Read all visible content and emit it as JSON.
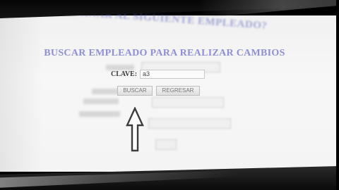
{
  "ghost": {
    "title": "DESEA ELIMINAR AL SIGUIENTE EMPLEADO?"
  },
  "page": {
    "heading": "BUSCAR EMPLEADO PARA REALIZAR CAMBIOS"
  },
  "form": {
    "clave_label": "CLAVE:",
    "clave_value": "a3"
  },
  "buttons": {
    "buscar": "BUSCAR",
    "regresar": "REGRESAR"
  },
  "colors": {
    "heading": "#8f8fd6",
    "background": "#f4f4f4"
  },
  "icons": {
    "pointer": "arrow-up-cursor-icon"
  }
}
